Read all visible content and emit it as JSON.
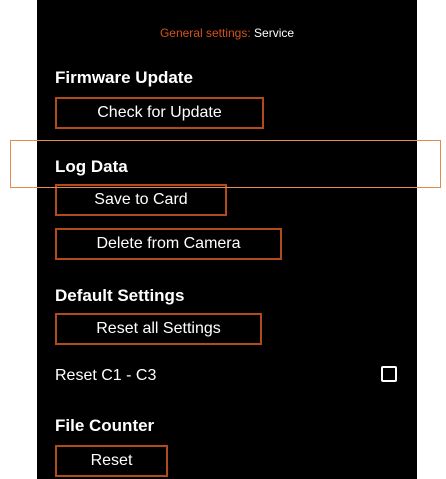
{
  "header": {
    "crumb": "General settings:",
    "current": "Service"
  },
  "sections": {
    "firmware": {
      "title": "Firmware Update",
      "check_button": "Check for Update"
    },
    "log": {
      "title": "Log Data",
      "save_button": "Save to Card",
      "delete_button": "Delete from Camera"
    },
    "defaults": {
      "title": "Default Settings",
      "reset_all_button": "Reset all Settings",
      "reset_c_label": "Reset C1 - C3",
      "reset_c_checked": false
    },
    "counter": {
      "title": "File Counter",
      "reset_button": "Reset"
    }
  },
  "colors": {
    "panel_bg": "#000000",
    "accent": "#d4521c",
    "button_border": "#b24a1c",
    "highlight": "#e58a4e"
  }
}
